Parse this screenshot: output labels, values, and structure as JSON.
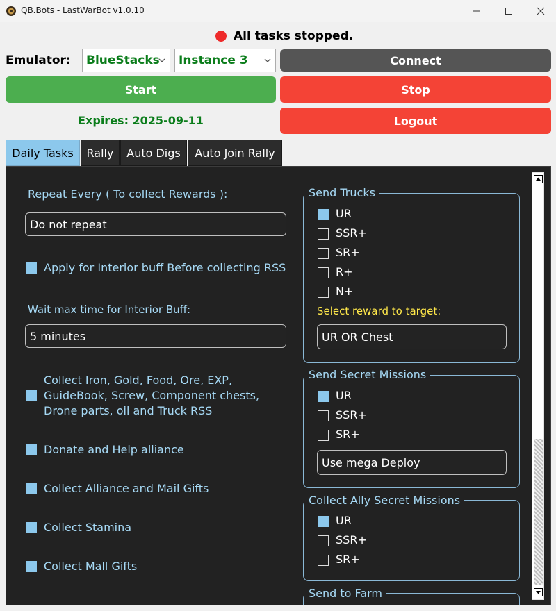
{
  "window": {
    "title": "QB.Bots - LastWarBot v1.0.10"
  },
  "status": {
    "text": "All tasks stopped."
  },
  "emulator": {
    "label": "Emulator:",
    "selected": "BlueStacks",
    "instance": "Instance 3"
  },
  "buttons": {
    "connect": "Connect",
    "start": "Start",
    "stop": "Stop",
    "logout": "Logout"
  },
  "expires": "Expires: 2025-09-11",
  "tabs": [
    "Daily Tasks",
    "Rally",
    "Auto Digs",
    "Auto Join Rally"
  ],
  "daily": {
    "repeat_label": "Repeat Every ( To collect Rewards ):",
    "repeat_value": "Do not repeat",
    "interior_buff": "Apply for Interior buff Before collecting RSS",
    "wait_label": "Wait max time for Interior Buff:",
    "wait_value": "5 minutes",
    "collect_lines": [
      "Collect Iron, Gold, Food, Ore, EXP,",
      "GuideBook, Screw, Component chests,",
      "Drone parts, oil and Truck RSS"
    ],
    "donate": "Donate and Help alliance",
    "gifts": "Collect Alliance and Mail Gifts",
    "stamina": "Collect Stamina",
    "mall": "Collect Mall Gifts"
  },
  "trucks": {
    "title": "Send Trucks",
    "options": [
      {
        "label": "UR",
        "checked": true
      },
      {
        "label": "SSR+",
        "checked": false
      },
      {
        "label": "SR+",
        "checked": false
      },
      {
        "label": "R+",
        "checked": false
      },
      {
        "label": "N+",
        "checked": false
      }
    ],
    "reward_label": "Select reward to target:",
    "reward_value": "UR OR Chest"
  },
  "secret": {
    "title": "Send Secret Missions",
    "options": [
      {
        "label": "UR",
        "checked": true
      },
      {
        "label": "SSR+",
        "checked": false
      },
      {
        "label": "SR+",
        "checked": false
      }
    ],
    "deploy": "Use mega Deploy"
  },
  "ally": {
    "title": "Collect Ally Secret Missions",
    "options": [
      {
        "label": "UR",
        "checked": true
      },
      {
        "label": "SSR+",
        "checked": false
      },
      {
        "label": "SR+",
        "checked": false
      }
    ]
  },
  "farm": {
    "title": "Send to Farm"
  },
  "colors": {
    "start": "#4cae4f",
    "stop": "#f44336",
    "connect": "#555555",
    "accent": "#8cc8ec",
    "panel": "#222222",
    "status_dot": "#ee2a2a"
  }
}
